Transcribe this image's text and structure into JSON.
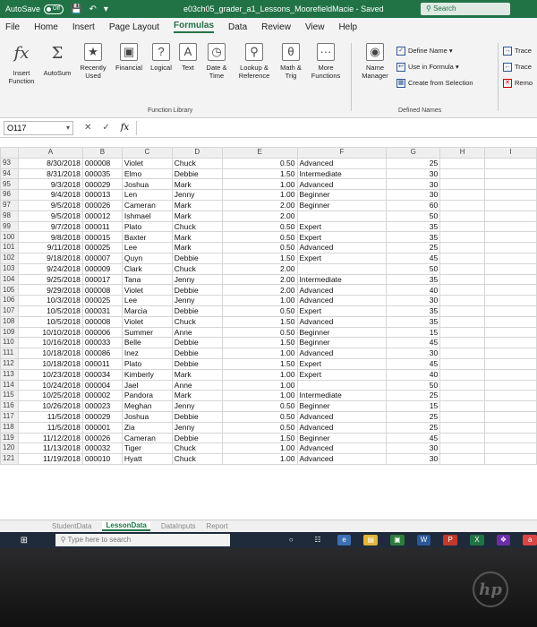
{
  "titlebar": {
    "autosave_label": "AutoSave",
    "autosave_state": "Off",
    "document_title": "e03ch05_grader_a1_Lessons_MoorefieldMacie - Saved",
    "search_label": "Search"
  },
  "menu_tabs": [
    "File",
    "Home",
    "Insert",
    "Page Layout",
    "Formulas",
    "Data",
    "Review",
    "View",
    "Help"
  ],
  "active_tab": "Formulas",
  "ribbon": {
    "insert_function": "Insert Function",
    "autosum": "AutoSum",
    "recently_used": "Recently Used",
    "financial": "Financial",
    "logical": "Logical",
    "text": "Text",
    "date_time": "Date & Time",
    "lookup_reference": "Lookup & Reference",
    "math_trig": "Math & Trig",
    "more_functions": "More Functions",
    "function_library_label": "Function Library",
    "name_manager": "Name Manager",
    "define_name": "Define Name",
    "use_in_formula": "Use in Formula",
    "create_from_selection": "Create from Selection",
    "defined_names_label": "Defined Names",
    "trace_precedents": "Trace",
    "trace_dependents": "Trace",
    "remove_arrows": "Remo"
  },
  "formula_bar": {
    "name_box": "O117",
    "cancel": "✕",
    "enter": "✓",
    "fx": "fx",
    "value": ""
  },
  "columns": [
    "A",
    "B",
    "C",
    "D",
    "E",
    "F",
    "G",
    "H",
    "I"
  ],
  "rows": [
    {
      "r": "93",
      "a": "8/30/2018",
      "b": "000008",
      "c": "Violet",
      "d": "Chuck",
      "e": "0.50",
      "f": "Advanced",
      "g": "25"
    },
    {
      "r": "94",
      "a": "8/31/2018",
      "b": "000035",
      "c": "Elmo",
      "d": "Debbie",
      "e": "1.50",
      "f": "Intermediate",
      "g": "30"
    },
    {
      "r": "95",
      "a": "9/3/2018",
      "b": "000029",
      "c": "Joshua",
      "d": "Mark",
      "e": "1.00",
      "f": "Advanced",
      "g": "30"
    },
    {
      "r": "96",
      "a": "9/4/2018",
      "b": "000013",
      "c": "Len",
      "d": "Jenny",
      "e": "1.00",
      "f": "Beginner",
      "g": "30"
    },
    {
      "r": "97",
      "a": "9/5/2018",
      "b": "000026",
      "c": "Cameran",
      "d": "Mark",
      "e": "2.00",
      "f": "Beginner",
      "g": "60"
    },
    {
      "r": "98",
      "a": "9/5/2018",
      "b": "000012",
      "c": "Ishmael",
      "d": "Mark",
      "e": "2.00",
      "f": "",
      "g": "50"
    },
    {
      "r": "99",
      "a": "9/7/2018",
      "b": "000011",
      "c": "Plato",
      "d": "Chuck",
      "e": "0.50",
      "f": "Expert",
      "g": "35"
    },
    {
      "r": "100",
      "a": "9/8/2018",
      "b": "000015",
      "c": "Baxter",
      "d": "Mark",
      "e": "0.50",
      "f": "Expert",
      "g": "35"
    },
    {
      "r": "101",
      "a": "9/11/2018",
      "b": "000025",
      "c": "Lee",
      "d": "Mark",
      "e": "0.50",
      "f": "Advanced",
      "g": "25"
    },
    {
      "r": "102",
      "a": "9/18/2018",
      "b": "000007",
      "c": "Quyn",
      "d": "Debbie",
      "e": "1.50",
      "f": "Expert",
      "g": "45"
    },
    {
      "r": "103",
      "a": "9/24/2018",
      "b": "000009",
      "c": "Clark",
      "d": "Chuck",
      "e": "2.00",
      "f": "",
      "g": "50"
    },
    {
      "r": "104",
      "a": "9/25/2018",
      "b": "000017",
      "c": "Tana",
      "d": "Jenny",
      "e": "2.00",
      "f": "Intermediate",
      "g": "35"
    },
    {
      "r": "105",
      "a": "9/29/2018",
      "b": "000008",
      "c": "Violet",
      "d": "Debbie",
      "e": "2.00",
      "f": "Advanced",
      "g": "40"
    },
    {
      "r": "106",
      "a": "10/3/2018",
      "b": "000025",
      "c": "Lee",
      "d": "Jenny",
      "e": "1.00",
      "f": "Advanced",
      "g": "30"
    },
    {
      "r": "107",
      "a": "10/5/2018",
      "b": "000031",
      "c": "Marcia",
      "d": "Debbie",
      "e": "0.50",
      "f": "Expert",
      "g": "35"
    },
    {
      "r": "108",
      "a": "10/5/2018",
      "b": "000008",
      "c": "Violet",
      "d": "Chuck",
      "e": "1.50",
      "f": "Advanced",
      "g": "35"
    },
    {
      "r": "109",
      "a": "10/10/2018",
      "b": "000006",
      "c": "Summer",
      "d": "Anne",
      "e": "0.50",
      "f": "Beginner",
      "g": "15"
    },
    {
      "r": "110",
      "a": "10/16/2018",
      "b": "000033",
      "c": "Belle",
      "d": "Debbie",
      "e": "1.50",
      "f": "Beginner",
      "g": "45"
    },
    {
      "r": "111",
      "a": "10/18/2018",
      "b": "000086",
      "c": "Inez",
      "d": "Debbie",
      "e": "1.00",
      "f": "Advanced",
      "g": "30"
    },
    {
      "r": "112",
      "a": "10/18/2018",
      "b": "000011",
      "c": "Plato",
      "d": "Debbie",
      "e": "1.50",
      "f": "Expert",
      "g": "45"
    },
    {
      "r": "113",
      "a": "10/23/2018",
      "b": "000034",
      "c": "Kimberly",
      "d": "Mark",
      "e": "1.00",
      "f": "Expert",
      "g": "40"
    },
    {
      "r": "114",
      "a": "10/24/2018",
      "b": "000004",
      "c": "Jael",
      "d": "Anne",
      "e": "1.00",
      "f": "",
      "g": "50"
    },
    {
      "r": "115",
      "a": "10/25/2018",
      "b": "000002",
      "c": "Pandora",
      "d": "Mark",
      "e": "1.00",
      "f": "Intermediate",
      "g": "25"
    },
    {
      "r": "116",
      "a": "10/26/2018",
      "b": "000023",
      "c": "Meghan",
      "d": "Jenny",
      "e": "0.50",
      "f": "Beginner",
      "g": "15"
    },
    {
      "r": "117",
      "a": "11/5/2018",
      "b": "000029",
      "c": "Joshua",
      "d": "Debbie",
      "e": "0.50",
      "f": "Advanced",
      "g": "25"
    },
    {
      "r": "118",
      "a": "11/5/2018",
      "b": "000001",
      "c": "Zia",
      "d": "Jenny",
      "e": "0.50",
      "f": "Advanced",
      "g": "25"
    },
    {
      "r": "119",
      "a": "11/12/2018",
      "b": "000026",
      "c": "Cameran",
      "d": "Debbie",
      "e": "1.50",
      "f": "Beginner",
      "g": "45"
    },
    {
      "r": "120",
      "a": "11/13/2018",
      "b": "000032",
      "c": "Tiger",
      "d": "Chuck",
      "e": "1.00",
      "f": "Advanced",
      "g": "30"
    },
    {
      "r": "121",
      "a": "11/19/2018",
      "b": "000010",
      "c": "Hyatt",
      "d": "Chuck",
      "e": "1.00",
      "f": "Advanced",
      "g": "30"
    }
  ],
  "sheet_tabs": [
    "StudentData",
    "LessonData",
    "DataInputs",
    "Report"
  ],
  "active_sheet": "LessonData",
  "taskbar": {
    "search_placeholder": "Type here to search"
  },
  "bezel_logo": "hp",
  "colors": {
    "excel_green": "#217346",
    "taskbar": "#1f2b3a"
  }
}
